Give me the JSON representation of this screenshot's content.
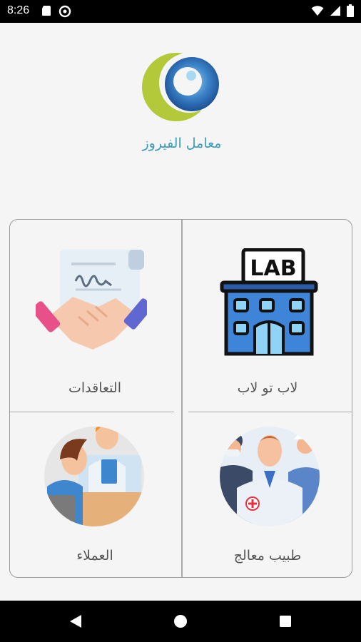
{
  "status_bar": {
    "time": "8:26",
    "left_icons": [
      "sd-card-icon",
      "data-saver-icon"
    ],
    "right_icons": [
      "wifi-icon",
      "signal-icon",
      "battery-icon"
    ]
  },
  "brand": {
    "name": "معامل الفيروز",
    "colors": {
      "green": "#b3c93a",
      "blue": "#2a6db5",
      "text": "#3d9db8"
    }
  },
  "tiles": [
    {
      "label": "لاب تو لاب",
      "icon": "lab-building-icon"
    },
    {
      "label": "التعاقدات",
      "icon": "handshake-contract-icon"
    },
    {
      "label": "طبيب معالج",
      "icon": "medical-team-icon"
    },
    {
      "label": "العملاء",
      "icon": "clients-icon"
    }
  ],
  "lab_sign": "LAB",
  "nav": [
    "back-icon",
    "home-icon",
    "recents-icon"
  ]
}
